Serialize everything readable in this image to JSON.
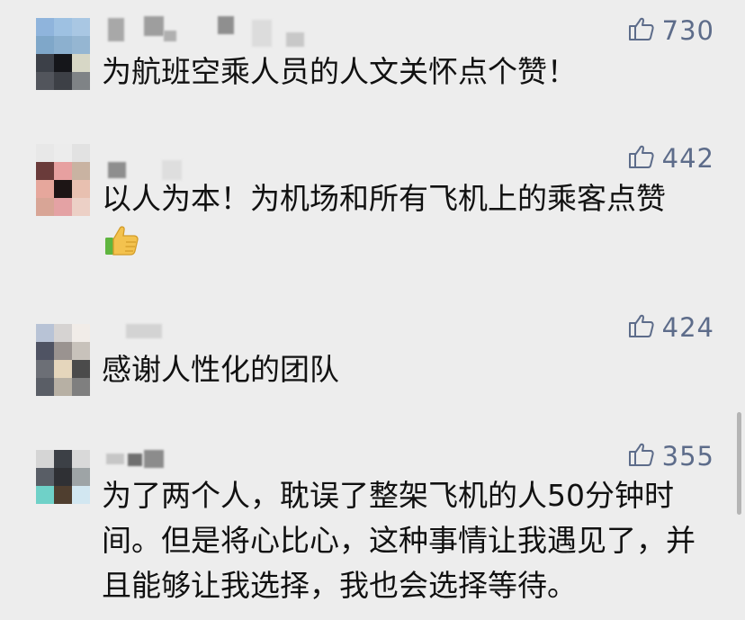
{
  "comments": [
    {
      "likes": "730",
      "text": "为航班空乘人员的人文关怀点个赞！"
    },
    {
      "likes": "442",
      "text": "以人为本！为机场和所有飞机上的乘客点赞",
      "emoji": "thumbs-up-emoji"
    },
    {
      "likes": "424",
      "text": "感谢人性化的团队"
    },
    {
      "likes": "355",
      "text": "为了两个人，耽误了整架飞机的人50分钟时间。但是将心比心，这种事情让我遇见了，并且能够让我选择，我也会选择等待。"
    }
  ],
  "icons": {
    "like": "thumbs-up-outline-icon"
  },
  "colors": {
    "background": "#ededed",
    "like_color": "#5d6c8a",
    "text_color": "#111111",
    "scrollbar": "#b5b5b5"
  }
}
